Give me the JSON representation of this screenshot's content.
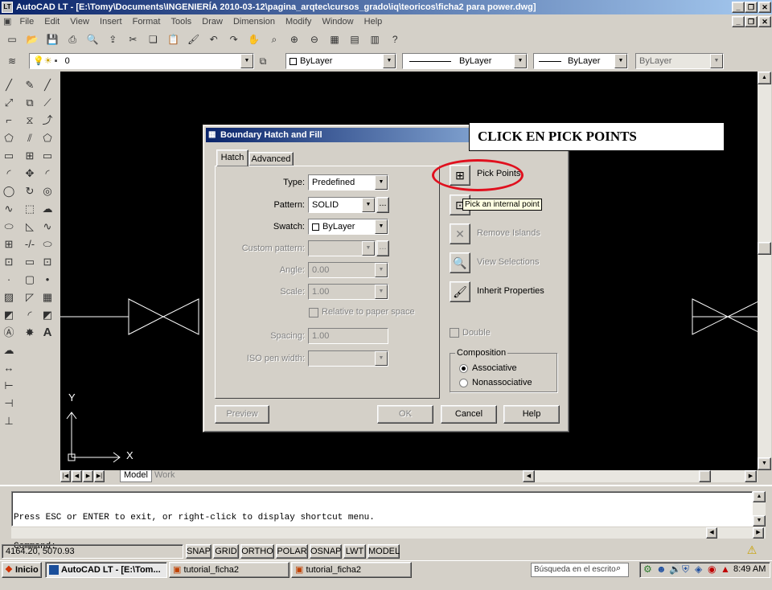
{
  "app": {
    "title": "AutoCAD LT - [E:\\Tomy\\Documents\\INGENIERÍA 2010-03-12\\pagina_arqtec\\cursos_grado\\iq\\teoricos\\ficha2 para power.dwg]",
    "icon_text": "LT"
  },
  "menu": [
    "File",
    "Edit",
    "View",
    "Insert",
    "Format",
    "Tools",
    "Draw",
    "Dimension",
    "Modify",
    "Window",
    "Help"
  ],
  "layer_toolbar": {
    "layer_value": "0",
    "color_value": "ByLayer",
    "linetype_value": "ByLayer",
    "lineweight_value": "ByLayer",
    "plotstyle_value": "ByLayer"
  },
  "annotation": {
    "text": "CLICK EN PICK POINTS",
    "highlight_color": "#e0101e"
  },
  "dialog": {
    "title": "Boundary Hatch and Fill",
    "tabs": [
      "Hatch",
      "Advanced"
    ],
    "fields": {
      "type_label": "Type:",
      "type_value": "Predefined",
      "pattern_label": "Pattern:",
      "pattern_value": "SOLID",
      "swatch_label": "Swatch:",
      "swatch_value": "ByLayer",
      "custom_label": "Custom pattern:",
      "custom_value": "",
      "angle_label": "Angle:",
      "angle_value": "0.00",
      "scale_label": "Scale:",
      "scale_value": "1.00",
      "relative_label": "Relative to paper space",
      "spacing_label": "Spacing:",
      "spacing_value": "1.00",
      "iso_label": "ISO pen width:",
      "iso_value": ""
    },
    "side": {
      "pick_points": "Pick Points",
      "tooltip": "Pick an internal point",
      "remove_islands": "Remove Islands",
      "view_selections": "View Selections",
      "inherit_properties": "Inherit Properties",
      "double": "Double",
      "composition_label": "Composition",
      "associative": "Associative",
      "nonassociative": "Nonassociative"
    },
    "buttons": {
      "preview": "Preview",
      "ok": "OK",
      "cancel": "Cancel",
      "help": "Help"
    }
  },
  "ucs": {
    "x": "X",
    "y": "Y"
  },
  "layout_tabs": [
    "Model",
    "Work"
  ],
  "command_lines": [
    "Press ESC or ENTER to exit, or right-click to display shortcut menu.",
    "Command:",
    "Command:"
  ],
  "status": {
    "coords": "4164.20, 5070.93",
    "toggles": [
      "SNAP",
      "GRID",
      "ORTHO",
      "POLAR",
      "OSNAP",
      "LWT",
      "MODEL"
    ]
  },
  "taskbar": {
    "start": "Inicio",
    "tasks": [
      "AutoCAD LT - [E:\\Tom...",
      "tutorial_ficha2",
      "tutorial_ficha2"
    ],
    "search_placeholder": "Búsqueda en el escrito",
    "clock": "8:49 AM"
  }
}
